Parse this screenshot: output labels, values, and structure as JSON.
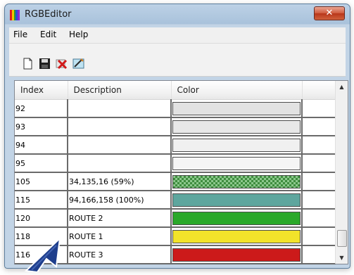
{
  "window": {
    "title": "RGBEditor",
    "close_glyph": "✕"
  },
  "app_icon": {
    "name": "rgb-stripes-icon",
    "stripes": [
      "#e11d1d",
      "#f2c500",
      "#2c9c2c",
      "#2c4fd8",
      "#8b2ad0"
    ]
  },
  "menu": [
    {
      "label": "File"
    },
    {
      "label": "Edit"
    },
    {
      "label": "Help"
    }
  ],
  "toolbar": [
    {
      "icon": "new-document-icon"
    },
    {
      "icon": "save-icon"
    },
    {
      "icon": "delete-icon"
    },
    {
      "icon": "edit-color-icon"
    }
  ],
  "table": {
    "headers": [
      "Index",
      "Description",
      "Color"
    ],
    "rows": [
      {
        "index": "92",
        "description": "",
        "color": "#e2e2e2",
        "pattern": false
      },
      {
        "index": "93",
        "description": "",
        "color": "#e8e8e8",
        "pattern": false
      },
      {
        "index": "94",
        "description": "",
        "color": "#f0f0f0",
        "pattern": false
      },
      {
        "index": "95",
        "description": "",
        "color": "#f5f5f5",
        "pattern": false
      },
      {
        "index": "105",
        "description": "34,135,16 (59%)",
        "color": "#8cc88c",
        "pattern": true
      },
      {
        "index": "115",
        "description": "94,166,158 (100%)",
        "color": "#5ea69e",
        "pattern": false
      },
      {
        "index": "120",
        "description": "ROUTE 2",
        "color": "#2aa82a",
        "pattern": false
      },
      {
        "index": "118",
        "description": "ROUTE 1",
        "color": "#f2e32a",
        "pattern": false
      },
      {
        "index": "116",
        "description": "ROUTE 3",
        "color": "#cc1a1a",
        "pattern": false
      }
    ]
  },
  "pointer": {
    "icon": "mouse-pointer-icon"
  }
}
